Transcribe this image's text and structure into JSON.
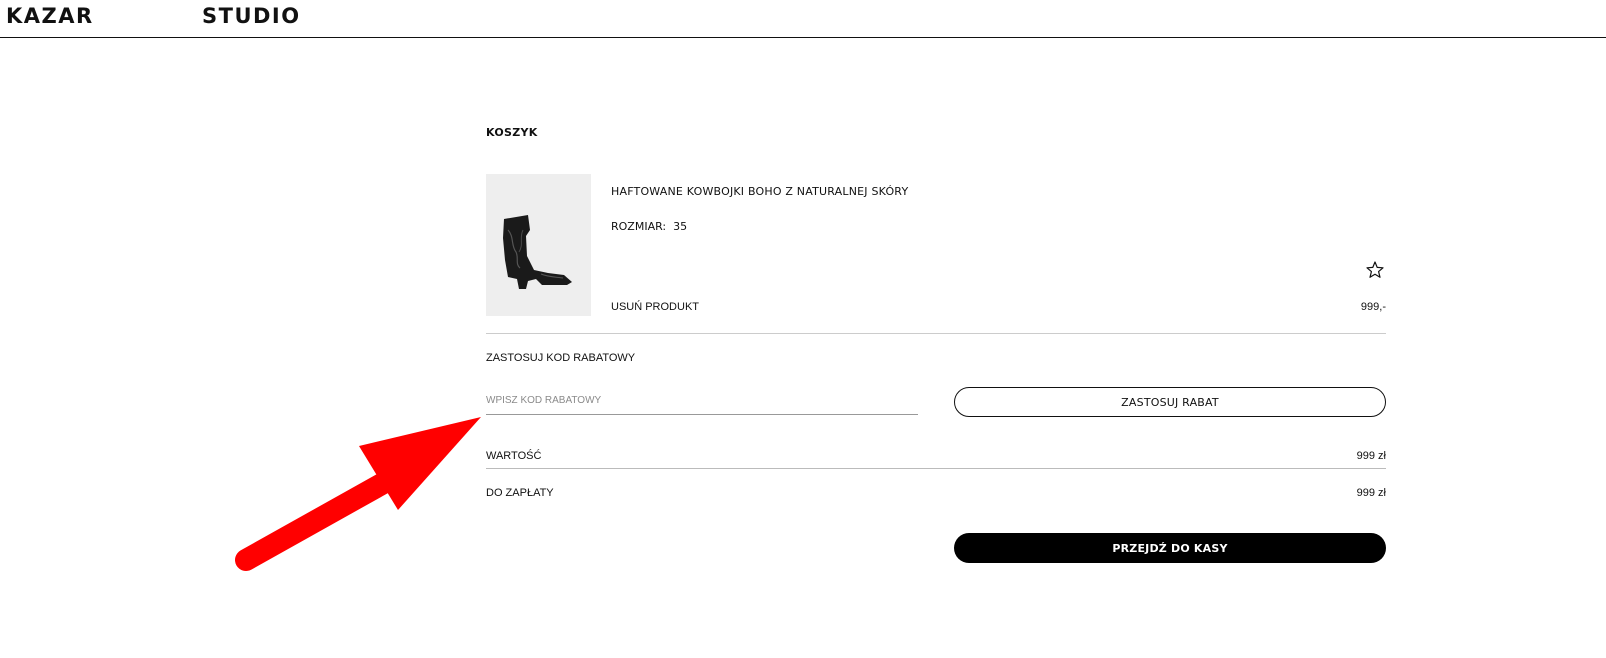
{
  "header": {
    "brand": "KAZAR",
    "sub_brand": "STUDIO"
  },
  "cart": {
    "title": "KOSZYK",
    "item": {
      "name": "HAFTOWANE KOWBOJKI BOHO Z NATURALNEJ SKÓRY",
      "size_label": "ROZMIAR:",
      "size_value": "35",
      "remove_label": "USUŃ PRODUKT",
      "price": "999,-",
      "image_icon": "cowboy-boot-image",
      "favorite_icon": "star-outline-icon"
    }
  },
  "discount": {
    "title": "ZASTOSUJ KOD RABATOWY",
    "input_placeholder": "WPISZ KOD RABATOWY",
    "input_value": "",
    "apply_label": "ZASTOSUJ RABAT"
  },
  "summary": {
    "value_label": "WARTOŚĆ",
    "value_amount": "999 zł",
    "total_label": "DO ZAPŁATY",
    "total_amount": "999 zł"
  },
  "checkout": {
    "label": "PRZEJDŹ DO KASY"
  },
  "annotation": {
    "arrow_color": "#ff0000"
  }
}
